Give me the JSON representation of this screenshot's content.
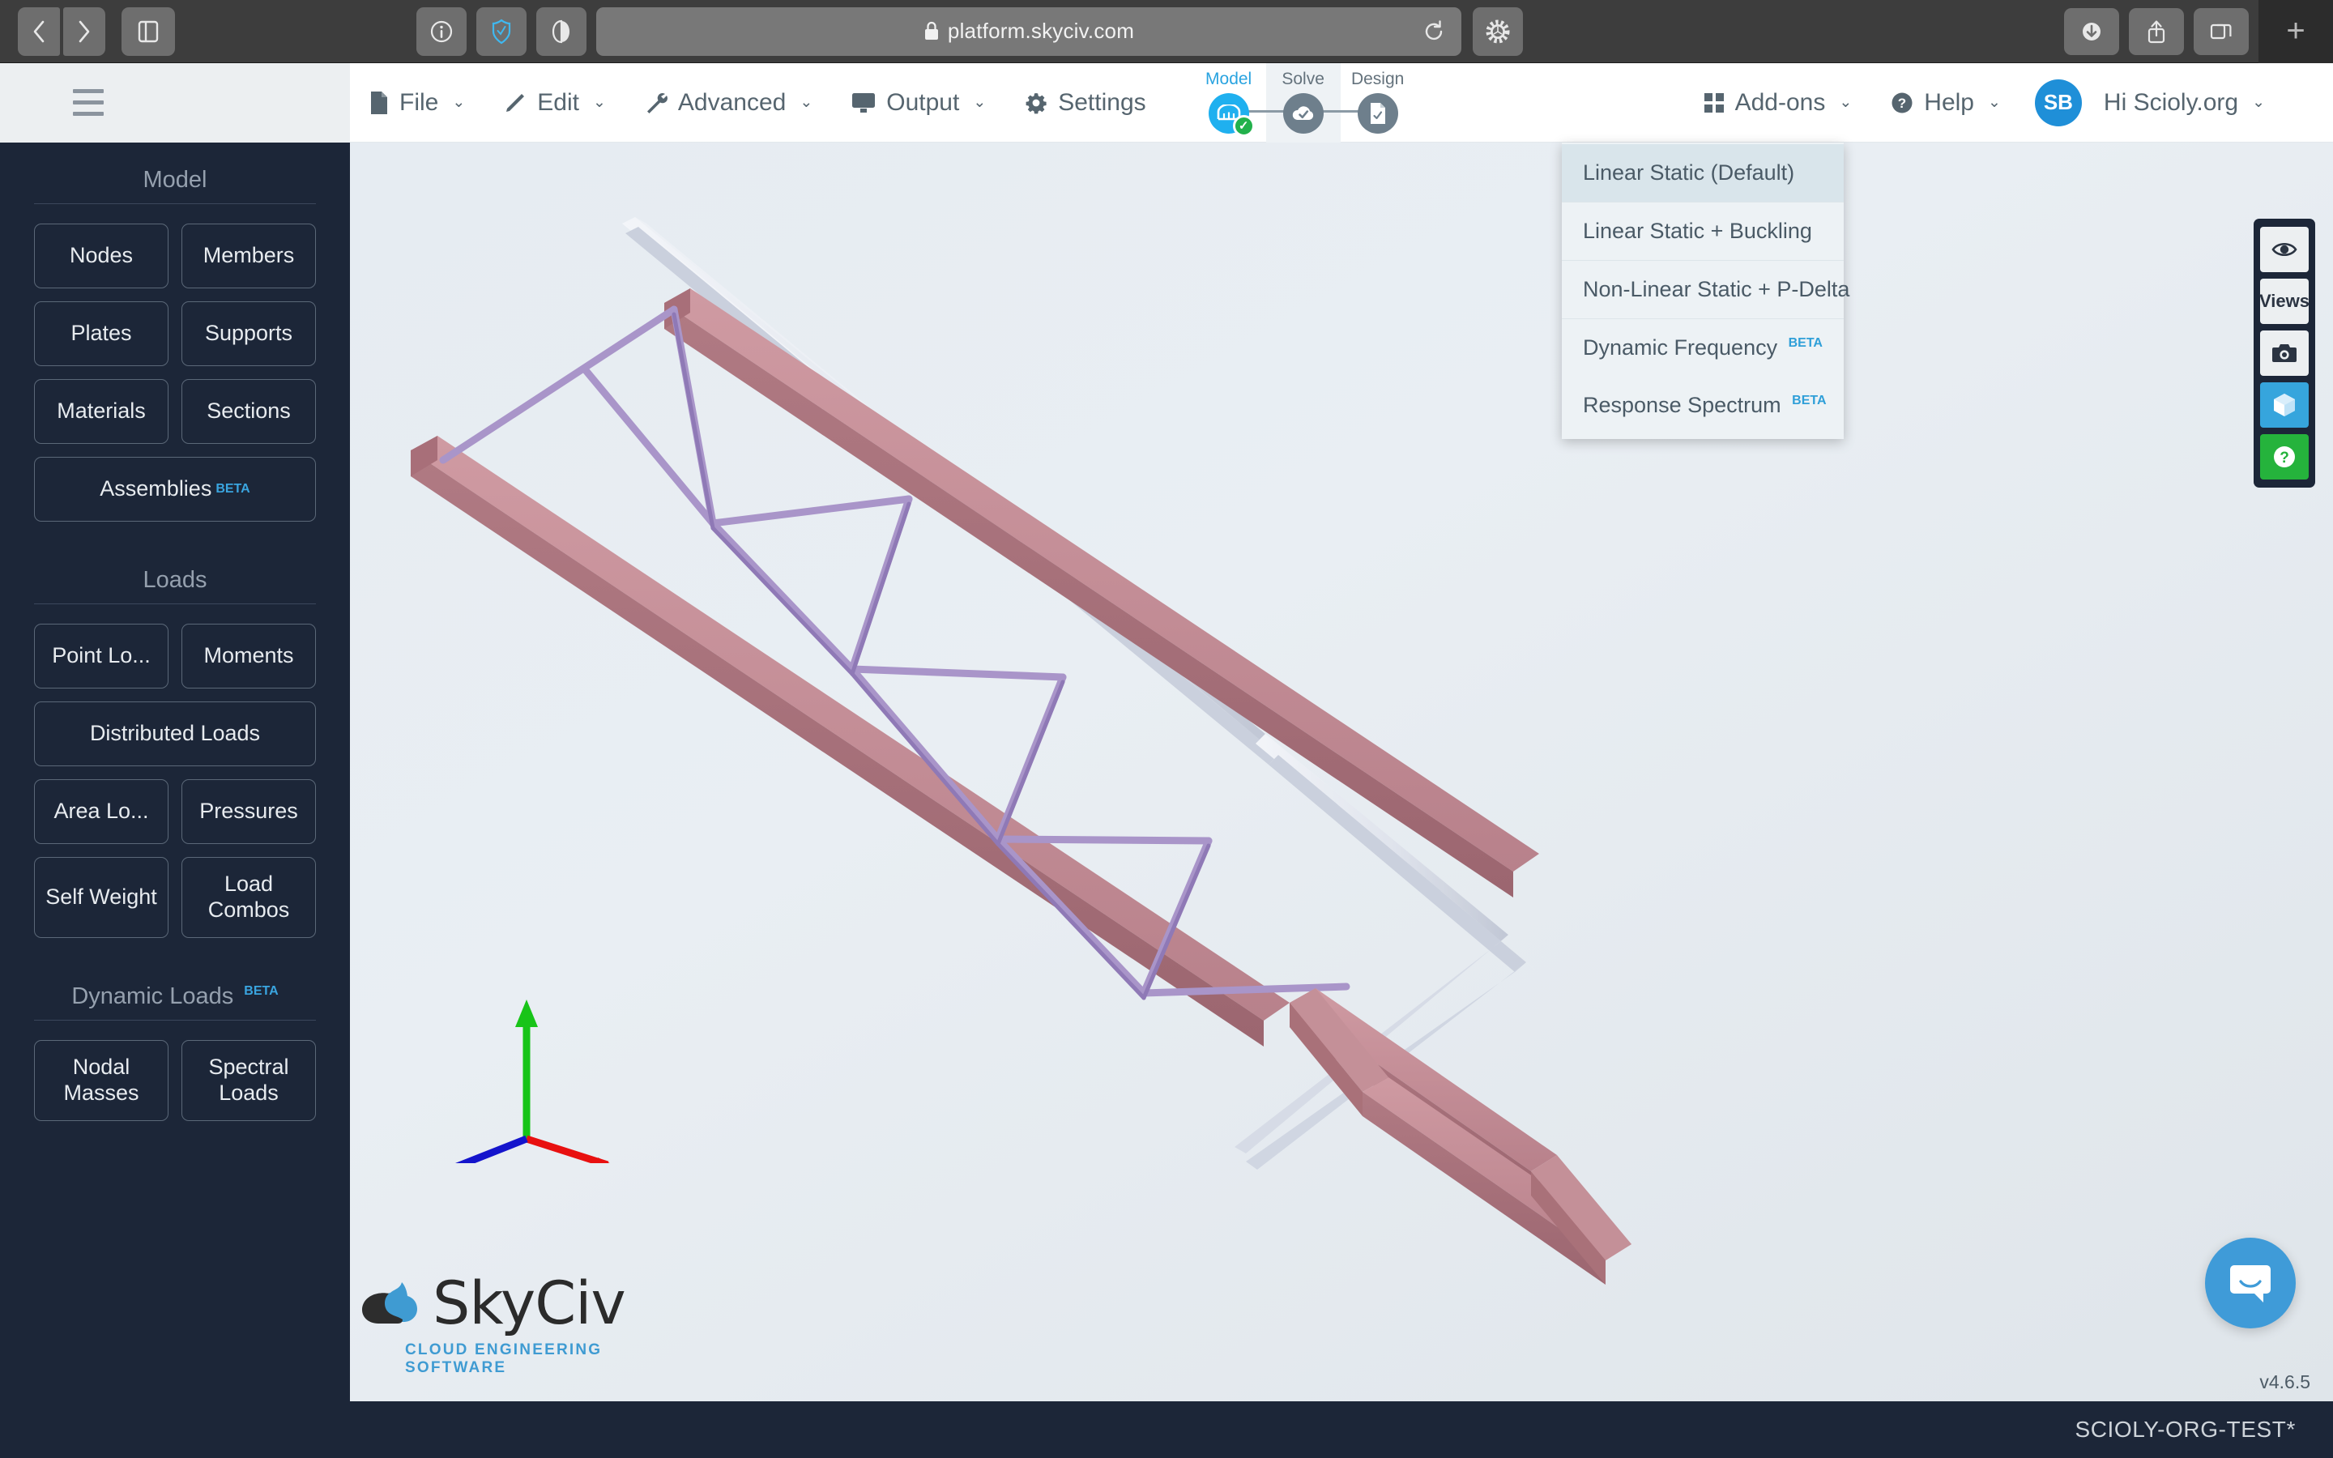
{
  "browser": {
    "url": "platform.skyciv.com",
    "nav_back_label": "‹",
    "nav_forward_label": "›",
    "icons": {
      "sidebar_toggle": "sidebar-toggle-icon",
      "info": "info-icon",
      "shield": "shield-check-icon",
      "reader": "reader-mode-icon",
      "lock": "lock-icon",
      "reload": "reload-icon",
      "extension_gear": "extension-gear-icon",
      "downloads": "download-icon",
      "share": "share-icon",
      "tabs": "tab-overview-icon",
      "new_tab": "+"
    }
  },
  "header": {
    "menu": [
      {
        "label": "File",
        "icon": "file-icon",
        "caret": "⌄"
      },
      {
        "label": "Edit",
        "icon": "pencil-icon",
        "caret": "⌄"
      },
      {
        "label": "Advanced",
        "icon": "wrench-icon",
        "caret": "⌄"
      },
      {
        "label": "Output",
        "icon": "monitor-icon",
        "caret": "⌄"
      },
      {
        "label": "Settings",
        "icon": "gear-icon",
        "caret": ""
      }
    ],
    "steps": [
      {
        "label": "Model",
        "icon": "bridge-icon",
        "state": "complete"
      },
      {
        "label": "Solve",
        "icon": "cloud-check-icon",
        "state": "active"
      },
      {
        "label": "Design",
        "icon": "document-check-icon",
        "state": "idle"
      }
    ],
    "right_menu": [
      {
        "label": "Add-ons",
        "icon": "grid-icon",
        "caret": "⌄"
      },
      {
        "label": "Help",
        "icon": "question-circle-icon",
        "caret": "⌄"
      }
    ],
    "user": {
      "initials": "SB",
      "greeting": "Hi Scioly.org",
      "caret": "⌄"
    }
  },
  "solve_dropdown": {
    "items": [
      {
        "label": "Linear Static (Default)",
        "beta": "",
        "selected": true
      },
      {
        "label": "Linear Static + Buckling",
        "beta": "",
        "selected": false
      },
      {
        "label": "Non-Linear Static + P-Delta",
        "beta": "",
        "selected": false
      },
      {
        "label": "Dynamic Frequency",
        "beta": "BETA",
        "selected": false
      },
      {
        "label": "Response Spectrum",
        "beta": "BETA",
        "selected": false
      }
    ]
  },
  "sidebar": {
    "sections": [
      {
        "title": "Model",
        "beta": "",
        "buttons": [
          {
            "label": "Nodes",
            "beta": "",
            "full": false
          },
          {
            "label": "Members",
            "beta": "",
            "full": false
          },
          {
            "label": "Plates",
            "beta": "",
            "full": false
          },
          {
            "label": "Supports",
            "beta": "",
            "full": false
          },
          {
            "label": "Materials",
            "beta": "",
            "full": false
          },
          {
            "label": "Sections",
            "beta": "",
            "full": false
          },
          {
            "label": "Assemblies",
            "beta": "BETA",
            "full": true
          }
        ]
      },
      {
        "title": "Loads",
        "beta": "",
        "buttons": [
          {
            "label": "Point Lo...",
            "beta": "",
            "full": false
          },
          {
            "label": "Moments",
            "beta": "",
            "full": false
          },
          {
            "label": "Distributed Loads",
            "beta": "",
            "full": true
          },
          {
            "label": "Area Lo...",
            "beta": "",
            "full": false
          },
          {
            "label": "Pressures",
            "beta": "",
            "full": false
          },
          {
            "label": "Self Weight",
            "beta": "",
            "full": false
          },
          {
            "label": "Load Combos",
            "beta": "",
            "full": false
          }
        ]
      },
      {
        "title": "Dynamic Loads",
        "beta": "BETA",
        "buttons": [
          {
            "label": "Nodal Masses",
            "beta": "",
            "full": false
          },
          {
            "label": "Spectral Loads",
            "beta": "",
            "full": false
          }
        ]
      }
    ]
  },
  "viewport": {
    "logo_text": "SkyCiv",
    "logo_tagline": "CLOUD ENGINEERING SOFTWARE",
    "axis_gizmo": {
      "x_color": "#e81010",
      "y_color": "#18c418",
      "z_color": "#1414cc"
    },
    "model_colors": {
      "chord": "#c08a92",
      "chord_shade": "#a4676f",
      "web": "#b7a6d4",
      "web_light": "#cfc2e4",
      "ghost": "#c3c8d6",
      "ghost_light": "#f2f4f8"
    }
  },
  "tool_rail": {
    "buttons": [
      {
        "name": "visibility",
        "label": "",
        "icon": "eye-icon",
        "style": "light"
      },
      {
        "name": "views",
        "label": "Views",
        "icon": "",
        "style": "light"
      },
      {
        "name": "screenshot",
        "label": "",
        "icon": "camera-icon",
        "style": "light"
      },
      {
        "name": "render-3d",
        "label": "",
        "icon": "cube-icon",
        "style": "blue"
      },
      {
        "name": "help",
        "label": "",
        "icon": "question-icon",
        "style": "green"
      }
    ]
  },
  "footer": {
    "version": "v4.6.5",
    "project_name": "SCIOLY-ORG-TEST*"
  },
  "chat": {
    "icon": "chat-bubble-icon"
  }
}
